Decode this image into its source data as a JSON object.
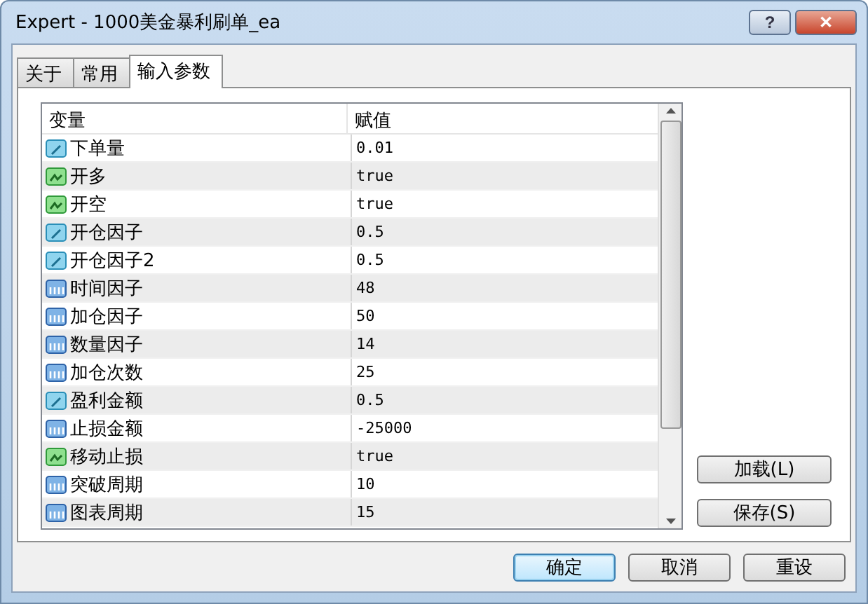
{
  "window": {
    "title": "Expert - 1000美金暴利刷单_ea",
    "buttons": [
      {
        "kind": "help",
        "label": "?"
      },
      {
        "kind": "close",
        "label": "✕"
      }
    ]
  },
  "tabs": [
    {
      "label": "关于",
      "selected": false
    },
    {
      "label": "常用",
      "selected": false
    },
    {
      "label": "输入参数",
      "selected": true
    }
  ],
  "table": {
    "columns": [
      "变量",
      "赋值"
    ],
    "rows": [
      {
        "kind": "double",
        "name": "下单量",
        "value": "0.01"
      },
      {
        "kind": "bool",
        "name": "开多",
        "value": "true"
      },
      {
        "kind": "bool",
        "name": "开空",
        "value": "true"
      },
      {
        "kind": "double",
        "name": "开仓因子",
        "value": "0.5"
      },
      {
        "kind": "double",
        "name": "开仓因子2",
        "value": "0.5"
      },
      {
        "kind": "int",
        "name": "时间因子",
        "value": "48"
      },
      {
        "kind": "int",
        "name": "加仓因子",
        "value": "50"
      },
      {
        "kind": "int",
        "name": "数量因子",
        "value": "14"
      },
      {
        "kind": "int",
        "name": "加仓次数",
        "value": "25"
      },
      {
        "kind": "double",
        "name": "盈利金额",
        "value": "0.5"
      },
      {
        "kind": "int",
        "name": "止损金额",
        "value": "-25000"
      },
      {
        "kind": "bool",
        "name": "移动止损",
        "value": "true"
      },
      {
        "kind": "int",
        "name": "突破周期",
        "value": "10"
      },
      {
        "kind": "int",
        "name": "图表周期",
        "value": "15"
      }
    ]
  },
  "side_buttons": [
    "加载(L)",
    "保存(S)"
  ],
  "footer_buttons": [
    {
      "label": "确定",
      "selected": true
    },
    {
      "label": "取消",
      "selected": false
    },
    {
      "label": "重设",
      "selected": false
    }
  ]
}
